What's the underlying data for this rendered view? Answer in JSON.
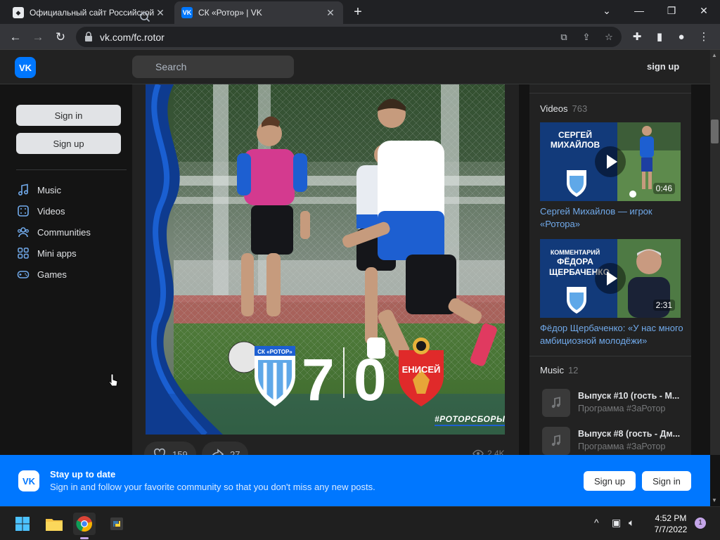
{
  "browser": {
    "tabs": [
      {
        "title": "Официальный сайт Российской",
        "favicon": "rotor-shield-icon"
      },
      {
        "title": "СК «Ротор» | VK",
        "favicon": "vk-icon",
        "active": true
      }
    ],
    "new_tab": "+",
    "url": "vk.com/fc.rotor",
    "window_controls": {
      "minimize": "—",
      "maximize": "❐",
      "close": "✕",
      "tab_search": "⌄"
    }
  },
  "vk_header": {
    "logo": "VK",
    "search_placeholder": "Search",
    "signup": "sign up"
  },
  "sidebar": {
    "sign_in": "Sign in",
    "sign_up": "Sign up",
    "nav": [
      {
        "label": "Music",
        "icon": "music-note-icon"
      },
      {
        "label": "Videos",
        "icon": "video-icon"
      },
      {
        "label": "Communities",
        "icon": "communities-icon"
      },
      {
        "label": "Mini apps",
        "icon": "mini-apps-icon"
      },
      {
        "label": "Games",
        "icon": "gamepad-icon"
      }
    ]
  },
  "post": {
    "score_home": "7",
    "score_away": "0",
    "home_team": "СК «РОТОР»",
    "away_team": "ЕНИСЕЙ",
    "hashtag": "#РОТОРСБОРЫ",
    "likes": "159",
    "shares": "27",
    "views": "2.4K"
  },
  "right": {
    "videos_label": "Videos",
    "videos_count": "763",
    "videos": [
      {
        "thumb_line1": "СЕРГЕЙ",
        "thumb_line2": "МИХАЙЛОВ",
        "duration": "0:46",
        "title": "Сергей Михайлов — игрок «Ротора»"
      },
      {
        "thumb_line0": "КОММЕНТАРИЙ",
        "thumb_line1": "ФЁДОРА",
        "thumb_line2": "ЩЕРБАЧЕНКО",
        "duration": "2:31",
        "title": "Фёдор Щербаченко: «У нас много амбициозной молодёжи»"
      }
    ],
    "music_label": "Music",
    "music_count": "12",
    "tracks": [
      {
        "title": "Выпуск #10 (гость - М...",
        "artist": "Программа #ЗаРотор"
      },
      {
        "title": "Выпуск #8 (гость - Дм...",
        "artist": "Программа #ЗаРотор"
      }
    ]
  },
  "banner": {
    "logo": "VK",
    "title": "Stay up to date",
    "text": "Sign in and follow your favorite community so that you don't miss any new posts.",
    "sign_up": "Sign up",
    "sign_in": "Sign in"
  },
  "taskbar": {
    "time": "4:52 PM",
    "date": "7/7/2022",
    "notifications": "1",
    "tray_chevron": "^"
  },
  "colors": {
    "vk_blue": "#0077ff",
    "link": "#71aaeb",
    "bg": "#141414",
    "card": "#222222"
  }
}
